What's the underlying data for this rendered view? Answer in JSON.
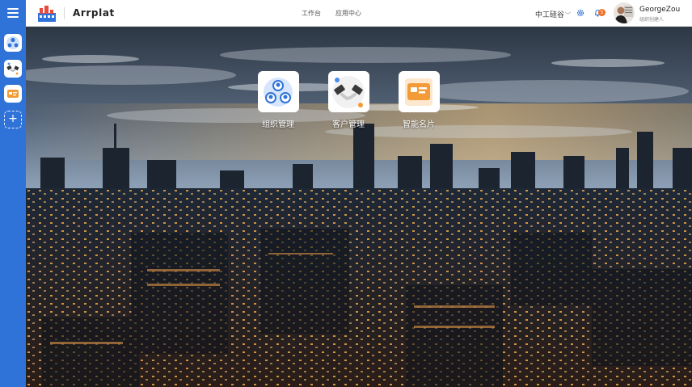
{
  "brand": {
    "name": "Arrplat"
  },
  "header": {
    "nav": [
      "工作台",
      "应用中心"
    ],
    "org": "中工硅谷",
    "notifications": "5",
    "user": {
      "name": "GeorgeZou",
      "role": "组织创建人"
    }
  },
  "apps": [
    {
      "label": "组织管理",
      "icon": "org-people-icon"
    },
    {
      "label": "客户管理",
      "icon": "handshake-icon"
    },
    {
      "label": "智能名片",
      "icon": "business-card-icon"
    }
  ],
  "colors": {
    "rail": "#2f73d8",
    "accent": "#f26d21",
    "card": "#f39b36"
  }
}
